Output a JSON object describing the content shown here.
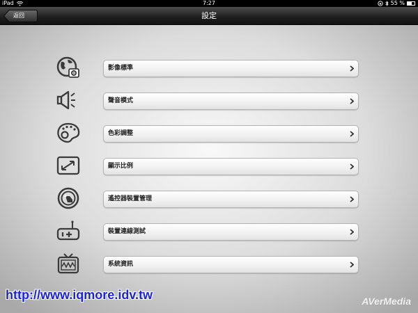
{
  "status_bar": {
    "device": "iPad",
    "time": "7:27",
    "battery_text": "55 %",
    "battery_level": 0.55,
    "icons": [
      "wifi-icon",
      "rotation-lock-icon",
      "bluetooth-icon",
      "battery-icon"
    ]
  },
  "nav_bar": {
    "title": "設定",
    "back_label": "返回"
  },
  "menu": {
    "items": [
      {
        "label": "影像標準",
        "icon": "globe-settings-icon"
      },
      {
        "label": "聲音模式",
        "icon": "speaker-icon"
      },
      {
        "label": "色彩調整",
        "icon": "color-palette-icon"
      },
      {
        "label": "顯示比例",
        "icon": "aspect-ratio-icon"
      },
      {
        "label": "遙控器裝置管理",
        "icon": "remote-device-icon"
      },
      {
        "label": "裝置連線測試",
        "icon": "device-connection-icon"
      },
      {
        "label": "系統資訊",
        "icon": "tv-info-icon"
      }
    ]
  },
  "overlay": {
    "watermark_url": "http://www.iqmore.idv.tw",
    "brand": "AVerMedia"
  },
  "colors": {
    "nav_bar": "#1e1e1e",
    "watermark": "#1a23d6",
    "icon_stroke": "#3a3a3a"
  }
}
